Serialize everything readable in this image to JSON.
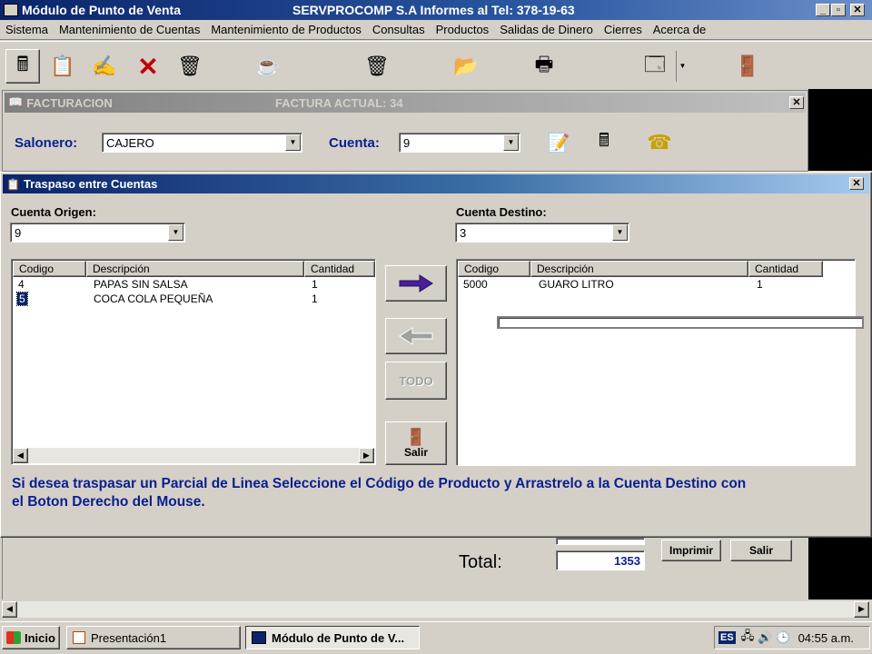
{
  "window": {
    "title": "Módulo de Punto de Venta",
    "company": "SERVPROCOMP S.A  Informes al Tel:  378-19-63",
    "min": "_",
    "max": "▫",
    "close": "✕"
  },
  "menu": [
    "Sistema",
    "Mantenimiento de Cuentas",
    "Mantenimiento de Productos",
    "Consultas",
    "Productos",
    "Salidas de Dinero",
    "Cierres",
    "Acerca de"
  ],
  "toolbar_icons": [
    "cash-register-icon",
    "edit-form-icon",
    "write-icon",
    "delete-icon",
    "wastebasket-icon",
    "coffee-maker-icon",
    "trash-can-icon",
    "reports-icon",
    "printer-icon",
    "calculator-icon",
    "exit-door-icon"
  ],
  "facturacion": {
    "title": "FACTURACION",
    "current_invoice": "FACTURA ACTUAL:  34",
    "salonero_label": "Salonero:",
    "salonero_value": "CAJERO",
    "cuenta_label": "Cuenta:",
    "cuenta_value": "9",
    "close": "✕",
    "total_label": "Total:",
    "total_value": "1353",
    "imprimir": "Imprimir",
    "salir": "Salir"
  },
  "traspaso": {
    "title": "Traspaso entre Cuentas",
    "close": "✕",
    "origen_label": "Cuenta Origen:",
    "origen_value": "9",
    "destino_label": "Cuenta Destino:",
    "destino_value": "3",
    "columns": [
      "Codigo",
      "Descripción",
      "Cantidad"
    ],
    "origen_rows": [
      {
        "codigo": "4",
        "descripcion": "PAPAS SIN SALSA",
        "cantidad": "1"
      },
      {
        "codigo": "5",
        "descripcion": "COCA COLA PEQUEÑA",
        "cantidad": "1"
      }
    ],
    "destino_rows": [
      {
        "codigo": "5000",
        "descripcion": "GUARO LITRO",
        "cantidad": "1"
      }
    ],
    "todo_label": "TODO",
    "salir_label": "Salir",
    "instructions_1": "Si desea traspasar un Parcial de Linea Seleccione el Código de Producto y Arrastrelo a la Cuenta Destino con",
    "instructions_2": "el Boton Derecho del Mouse."
  },
  "taskbar": {
    "start": "Inicio",
    "tasks": [
      "Presentación1",
      "Módulo de Punto de V..."
    ],
    "lang": "ES",
    "clock": "04:55 a.m."
  },
  "colors": {
    "title_blue": "#0a246a",
    "text_blue": "#0a1f8f",
    "arrow_purple": "#4b1e9c"
  }
}
